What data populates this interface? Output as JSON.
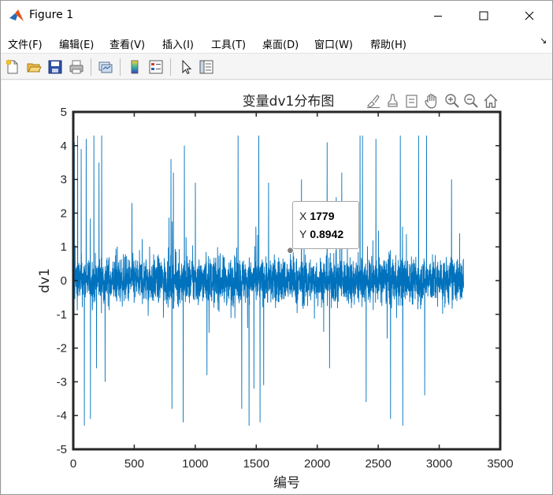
{
  "window": {
    "title": "Figure 1",
    "icon": "matlab-icon"
  },
  "titlebar_buttons": {
    "minimize": "minimize-icon",
    "maximize": "maximize-icon",
    "close": "close-icon"
  },
  "menu": {
    "items": [
      "文件(F)",
      "编辑(E)",
      "查看(V)",
      "插入(I)",
      "工具(T)",
      "桌面(D)",
      "窗口(W)",
      "帮助(H)"
    ],
    "overflow_arrow": "↘"
  },
  "toolbar": {
    "icons": [
      "new-figure-icon",
      "open-file-icon",
      "save-icon",
      "print-icon",
      "link-plot-icon",
      "insert-colorbar-icon",
      "insert-legend-icon",
      "edit-plot-icon",
      "property-inspector-icon"
    ]
  },
  "axes_toolbar": {
    "icons": [
      "brush-icon",
      "data-tips-icon",
      "rotate-icon",
      "pan-icon",
      "zoom-in-icon",
      "zoom-out-icon",
      "restore-view-icon"
    ]
  },
  "chart_data": {
    "type": "line",
    "title": "变量dv1分布图",
    "xlabel": "编号",
    "ylabel": "dv1",
    "xlim": [
      0,
      3500
    ],
    "ylim": [
      -5,
      5
    ],
    "xticks": [
      "0",
      "500",
      "1000",
      "1500",
      "2000",
      "2500",
      "3000",
      "3500"
    ],
    "yticks": [
      "-5",
      "-4",
      "-3",
      "-2",
      "-1",
      "0",
      "1",
      "2",
      "3",
      "4",
      "5"
    ],
    "grid": false,
    "series_color": "#0072BD",
    "n_points": 3200,
    "value_range": [
      -4.3,
      4.3
    ],
    "series": [
      {
        "spikes": [
          [
            8,
            4.1
          ],
          [
            35,
            4.3
          ],
          [
            64,
            3.9
          ],
          [
            90,
            -4.3
          ],
          [
            105,
            4.2
          ],
          [
            140,
            -4.1
          ],
          [
            168,
            4.3
          ],
          [
            190,
            -2.6
          ],
          [
            210,
            3.5
          ],
          [
            232,
            4.3
          ],
          [
            260,
            -3.0
          ],
          [
            480,
            2.3
          ],
          [
            800,
            3.6
          ],
          [
            808,
            -3.8
          ],
          [
            820,
            3.2
          ],
          [
            900,
            -4.2
          ],
          [
            910,
            4.0
          ],
          [
            1000,
            2.9
          ],
          [
            1095,
            -2.8
          ],
          [
            1350,
            4.3
          ],
          [
            1380,
            -3.8
          ],
          [
            1440,
            -4.3
          ],
          [
            1480,
            -3.2
          ],
          [
            1520,
            4.3
          ],
          [
            1530,
            -4.2
          ],
          [
            1560,
            -3.1
          ],
          [
            1600,
            2.9
          ],
          [
            1870,
            3.0
          ],
          [
            2080,
            4.1
          ],
          [
            2100,
            -2.6
          ],
          [
            2200,
            3.2
          ],
          [
            2350,
            4.3
          ],
          [
            2370,
            4.3
          ],
          [
            2400,
            -3.6
          ],
          [
            2480,
            4.2
          ],
          [
            2600,
            -4.1
          ],
          [
            2680,
            4.3
          ],
          [
            2700,
            -4.3
          ],
          [
            2830,
            4.3
          ],
          [
            2880,
            -3.4
          ],
          [
            2895,
            4.3
          ],
          [
            3100,
            3.0
          ]
        ]
      }
    ],
    "datatip": {
      "x": 1779,
      "y": 0.8942,
      "x_label": "X",
      "y_label": "Y",
      "x_text": "1779",
      "y_text": "0.8942"
    }
  }
}
